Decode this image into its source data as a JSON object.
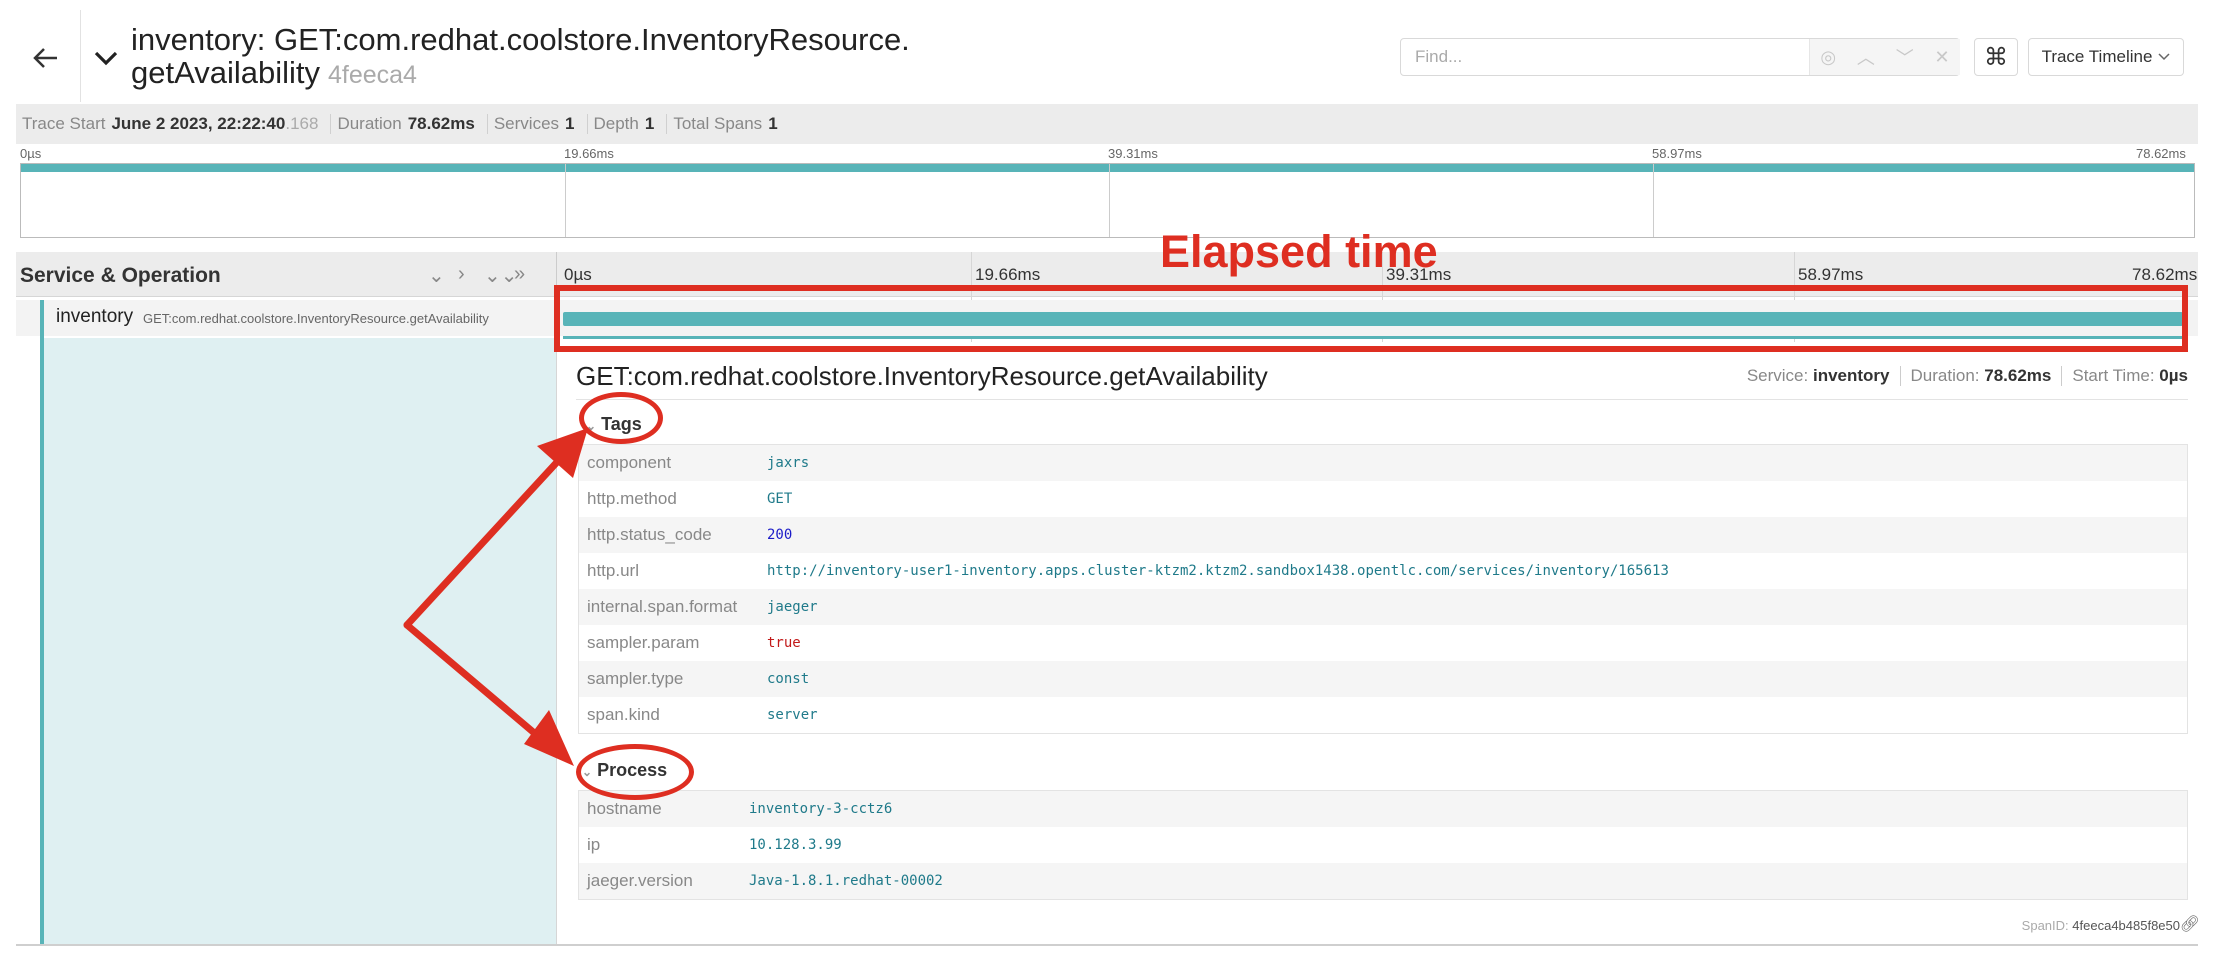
{
  "header": {
    "title_line1": "inventory: GET:com.redhat.coolstore.InventoryResource.",
    "title_line2": "getAvailability",
    "trace_id_short": "4feeca4",
    "find_placeholder": "Find...",
    "view_mode": "Trace Timeline"
  },
  "trace_info": {
    "trace_start_label": "Trace Start",
    "trace_start_value": "June 2 2023, 22:22:40",
    "trace_start_ms": ".168",
    "duration_label": "Duration",
    "duration_value": "78.62ms",
    "services_label": "Services",
    "services_value": "1",
    "depth_label": "Depth",
    "depth_value": "1",
    "total_spans_label": "Total Spans",
    "total_spans_value": "1"
  },
  "minimap": {
    "ticks": [
      "0µs",
      "19.66ms",
      "39.31ms",
      "58.97ms",
      "78.62ms"
    ]
  },
  "timeline_header": {
    "service_operation_label": "Service & Operation",
    "ticks": [
      "0µs",
      "19.66ms",
      "39.31ms",
      "58.97ms",
      "78.62ms"
    ]
  },
  "span": {
    "service": "inventory",
    "operation": "GET:com.redhat.coolstore.InventoryResource.getAvailability",
    "bar_start_fraction": 0,
    "bar_end_fraction": 1
  },
  "detail": {
    "title": "GET:com.redhat.coolstore.InventoryResource.getAvailability",
    "service_label": "Service:",
    "service_value": "inventory",
    "duration_label": "Duration:",
    "duration_value": "78.62ms",
    "start_label": "Start Time:",
    "start_value": "0µs",
    "tags_label": "Tags",
    "tags": [
      {
        "key": "component",
        "value": "jaxrs"
      },
      {
        "key": "http.method",
        "value": "GET"
      },
      {
        "key": "http.status_code",
        "value": "200"
      },
      {
        "key": "http.url",
        "value": "http://inventory-user1-inventory.apps.cluster-ktzm2.ktzm2.sandbox1438.opentlc.com/services/inventory/165613"
      },
      {
        "key": "internal.span.format",
        "value": "jaeger"
      },
      {
        "key": "sampler.param",
        "value": "true"
      },
      {
        "key": "sampler.type",
        "value": "const"
      },
      {
        "key": "span.kind",
        "value": "server"
      }
    ],
    "process_label": "Process",
    "process": [
      {
        "key": "hostname",
        "value": "inventory-3-cctz6"
      },
      {
        "key": "ip",
        "value": "10.128.3.99"
      },
      {
        "key": "jaeger.version",
        "value": "Java-1.8.1.redhat-00002"
      }
    ],
    "span_id_label": "SpanID:",
    "span_id_value": "4feeca4b485f8e50"
  },
  "annotations": {
    "elapsed_label": "Elapsed time",
    "color": "#de2e21"
  },
  "colors": {
    "span_bar": "#58b4b8",
    "left_panel": "#dff0f2",
    "numeric_value": "#1c1cc8",
    "boolean_value": "#c21a1a",
    "string_value": "#1f7a8a"
  }
}
